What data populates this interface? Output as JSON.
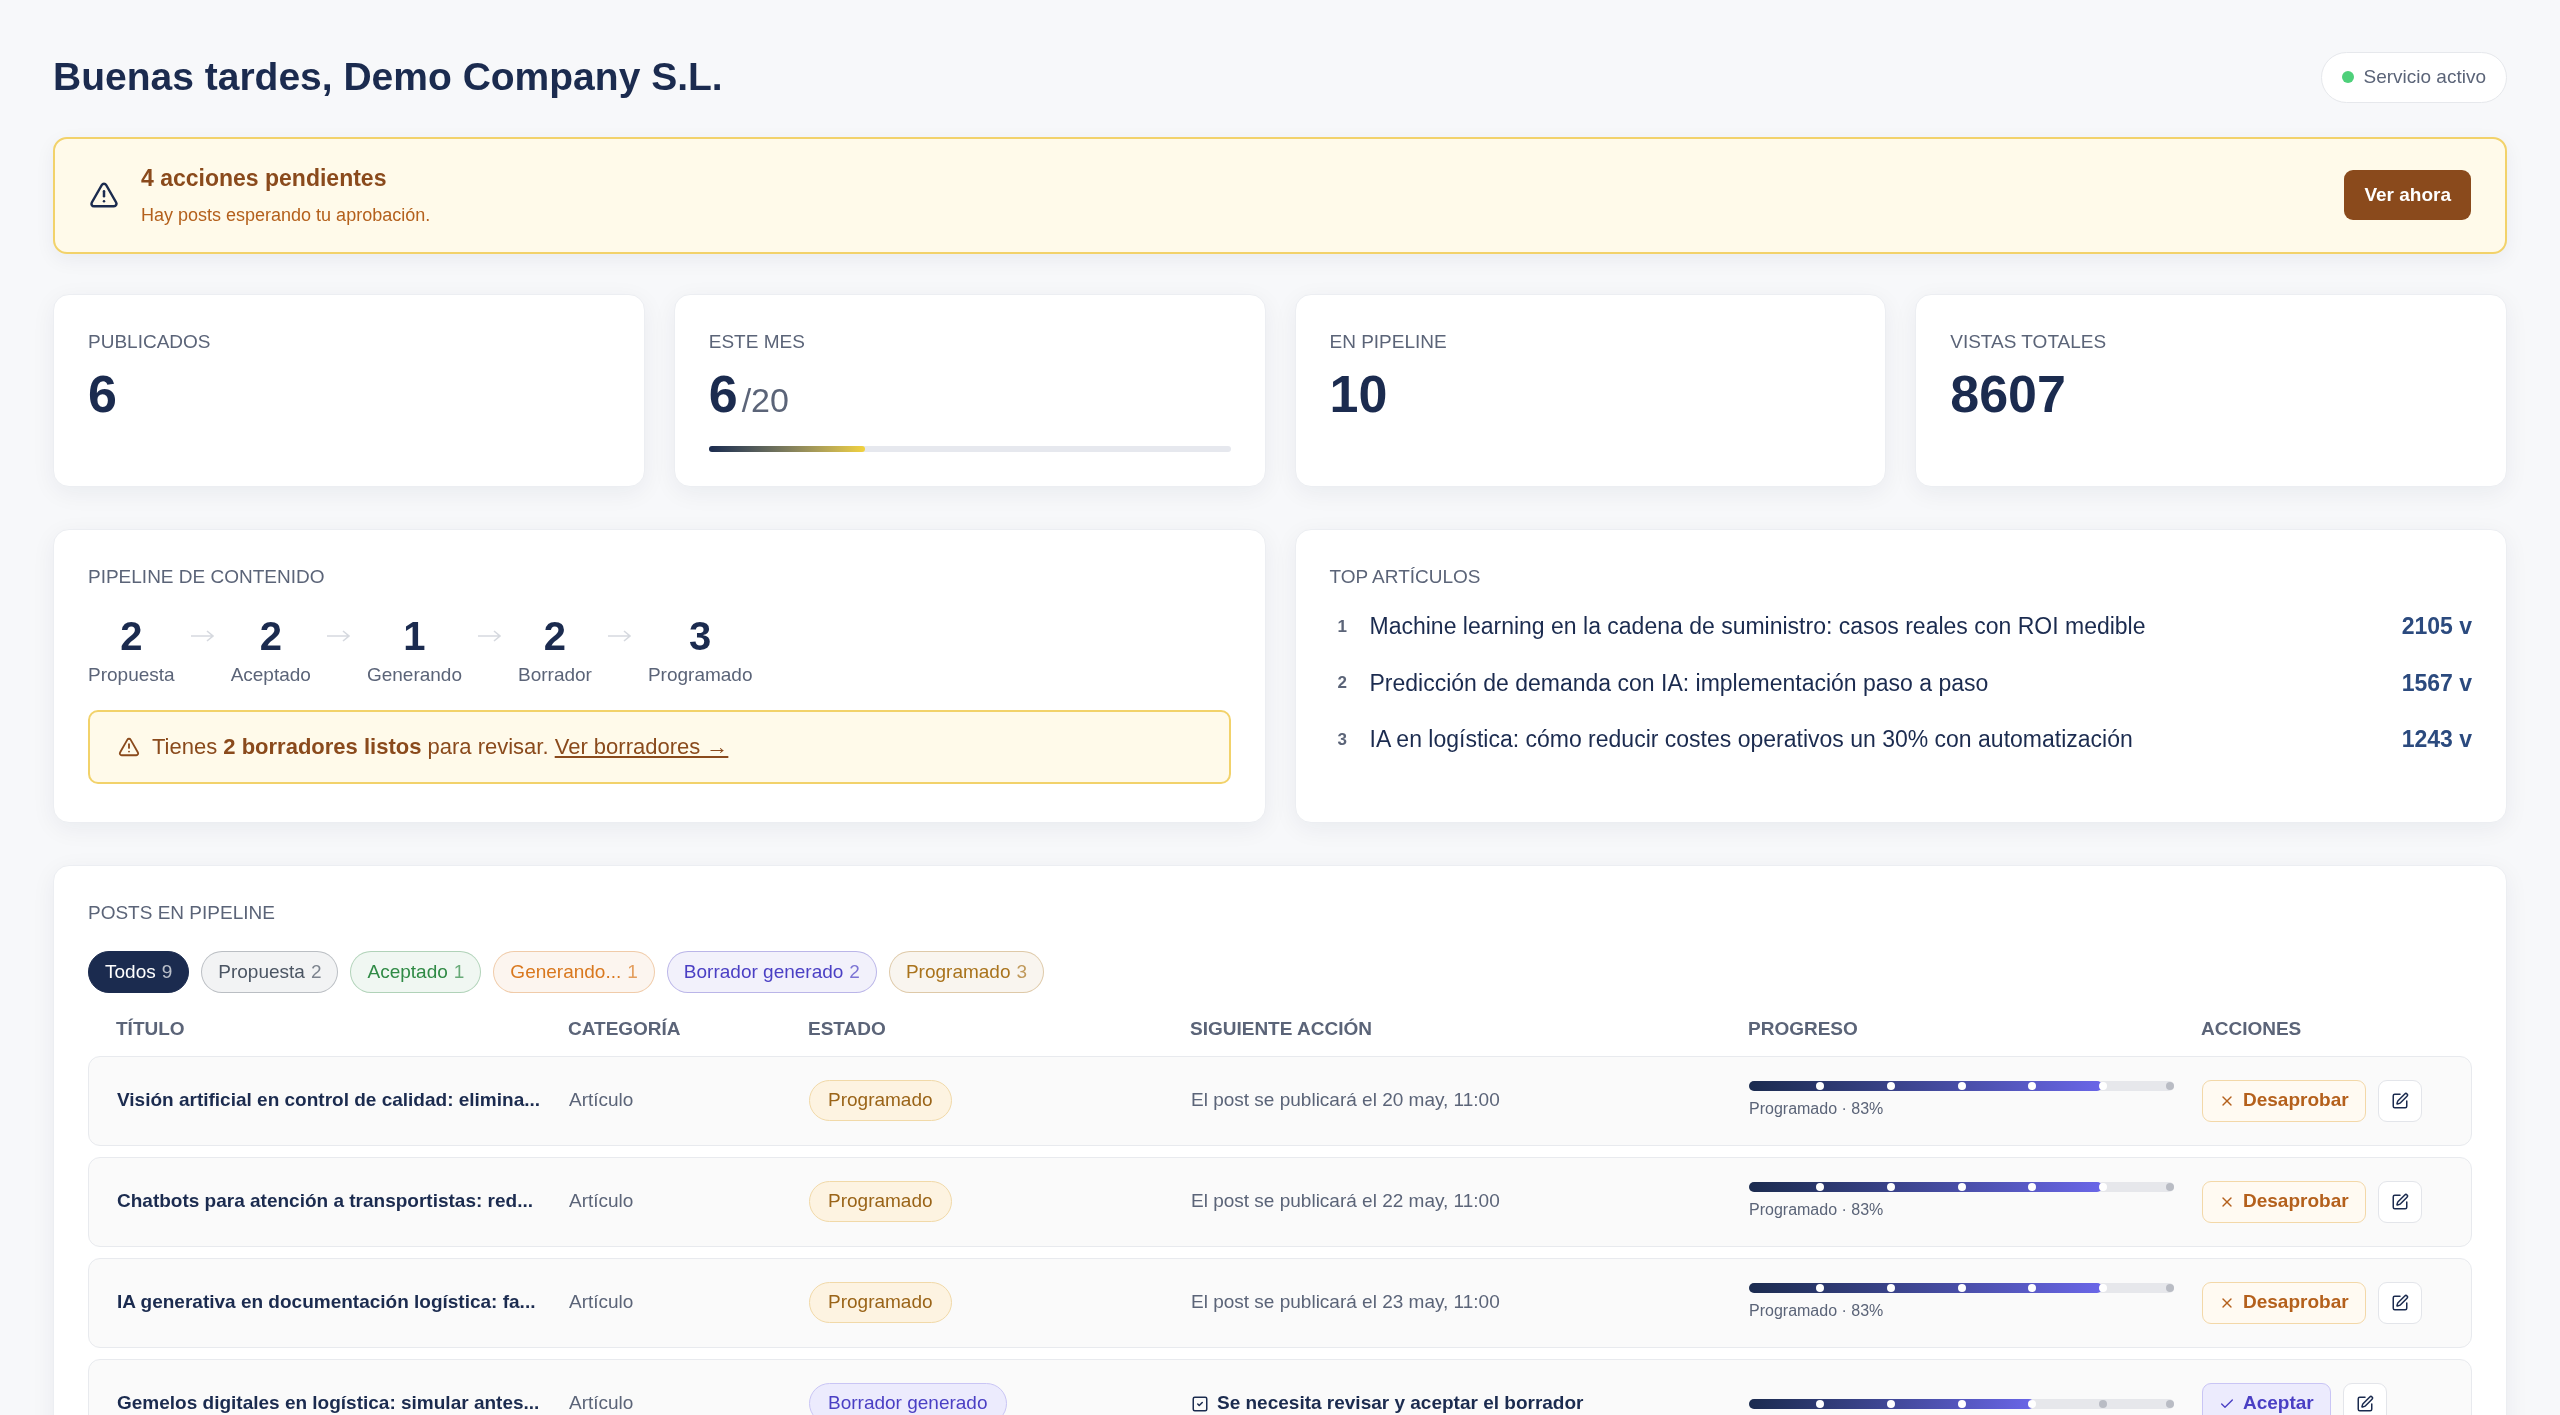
{
  "greeting": "Buenas tardes, Demo Company S.L.",
  "service_status": {
    "label": "Servicio activo",
    "on": true
  },
  "alert": {
    "title": "4 acciones pendientes",
    "message": "Hay posts esperando tu aprobación.",
    "button": "Ver ahora"
  },
  "stats": [
    {
      "label": "PUBLICADOS",
      "value": "6"
    },
    {
      "label": "ESTE MES",
      "value": "6",
      "total": "/20",
      "level": 0.3
    },
    {
      "label": "EN PIPELINE",
      "value": "10"
    },
    {
      "label": "VISTAS TOTALES",
      "value": "8607"
    }
  ],
  "pipeline": {
    "title": "PIPELINE DE CONTENIDO",
    "stages": [
      {
        "count": "2",
        "label": "Propuesta"
      },
      {
        "count": "2",
        "label": "Aceptado"
      },
      {
        "count": "1",
        "label": "Generando"
      },
      {
        "count": "2",
        "label": "Borrador"
      },
      {
        "count": "3",
        "label": "Programado"
      }
    ],
    "notice": "Tienes **2 borradores listos** para revisar.",
    "notice_link": "Ver borradores →"
  },
  "top_articles": {
    "title": "TOP ARTÍCULOS",
    "items": [
      {
        "rank": "1",
        "title": "Machine learning en la cadena de suministro: casos reales con ROI medible",
        "views": "2105 v"
      },
      {
        "rank": "2",
        "title": "Predicción de demanda con IA: implementación paso a paso",
        "views": "1567 v"
      },
      {
        "rank": "3",
        "title": "IA en logística: cómo reducir costes operativos un 30% con automatización",
        "views": "1243 v"
      }
    ]
  },
  "posts": {
    "title": "POSTS EN PIPELINE",
    "filters": [
      {
        "label": "Todos",
        "count": "9",
        "selected": true,
        "color": "#1b2b4f"
      },
      {
        "label": "Propuesta",
        "count": "2",
        "selected": false,
        "color": "#4b5563"
      },
      {
        "label": "Aceptado",
        "count": "1",
        "selected": false,
        "color": "#2f8a45"
      },
      {
        "label": "Generando...",
        "count": "1",
        "selected": false,
        "color": "#d9781e"
      },
      {
        "label": "Borrador generado",
        "count": "2",
        "selected": false,
        "color": "#4a3fc4"
      },
      {
        "label": "Programado",
        "count": "3",
        "selected": false,
        "color": "#a9731c"
      }
    ],
    "columns": [
      "TÍTULO",
      "CATEGORÍA",
      "ESTADO",
      "SIGUIENTE ACCIÓN",
      "PROGRESO",
      "ACCIONES"
    ],
    "rows": [
      {
        "title": "Visión artificial en control de calidad: elimina...",
        "category": "Artículo",
        "status": {
          "label": "Programado",
          "kind": "scheduled"
        },
        "next_action": {
          "text": "El post se publicará el 20 may, 11:00",
          "kind": "info"
        },
        "progress": {
          "level": 0.83,
          "label": "Programado · 83%"
        },
        "action": {
          "label": "Desaprobar",
          "kind": "unapprove"
        }
      },
      {
        "title": "Chatbots para atención a transportistas: red...",
        "category": "Artículo",
        "status": {
          "label": "Programado",
          "kind": "scheduled"
        },
        "next_action": {
          "text": "El post se publicará el 22 may, 11:00",
          "kind": "info"
        },
        "progress": {
          "level": 0.83,
          "label": "Programado · 83%"
        },
        "action": {
          "label": "Desaprobar",
          "kind": "unapprove"
        }
      },
      {
        "title": "IA generativa en documentación logística: fa...",
        "category": "Artículo",
        "status": {
          "label": "Programado",
          "kind": "scheduled"
        },
        "next_action": {
          "text": "El post se publicará el 23 may, 11:00",
          "kind": "info"
        },
        "progress": {
          "level": 0.83,
          "label": "Programado · 83%"
        },
        "action": {
          "label": "Desaprobar",
          "kind": "unapprove"
        }
      },
      {
        "title": "Gemelos digitales en logística: simular antes...",
        "category": "Artículo",
        "status": {
          "label": "Borrador generado",
          "kind": "draft"
        },
        "next_action": {
          "text": "Se necesita revisar y aceptar el borrador",
          "kind": "task"
        },
        "progress": {
          "level": 0.67
        },
        "action": {
          "label": "Aceptar",
          "kind": "accept"
        }
      }
    ]
  }
}
